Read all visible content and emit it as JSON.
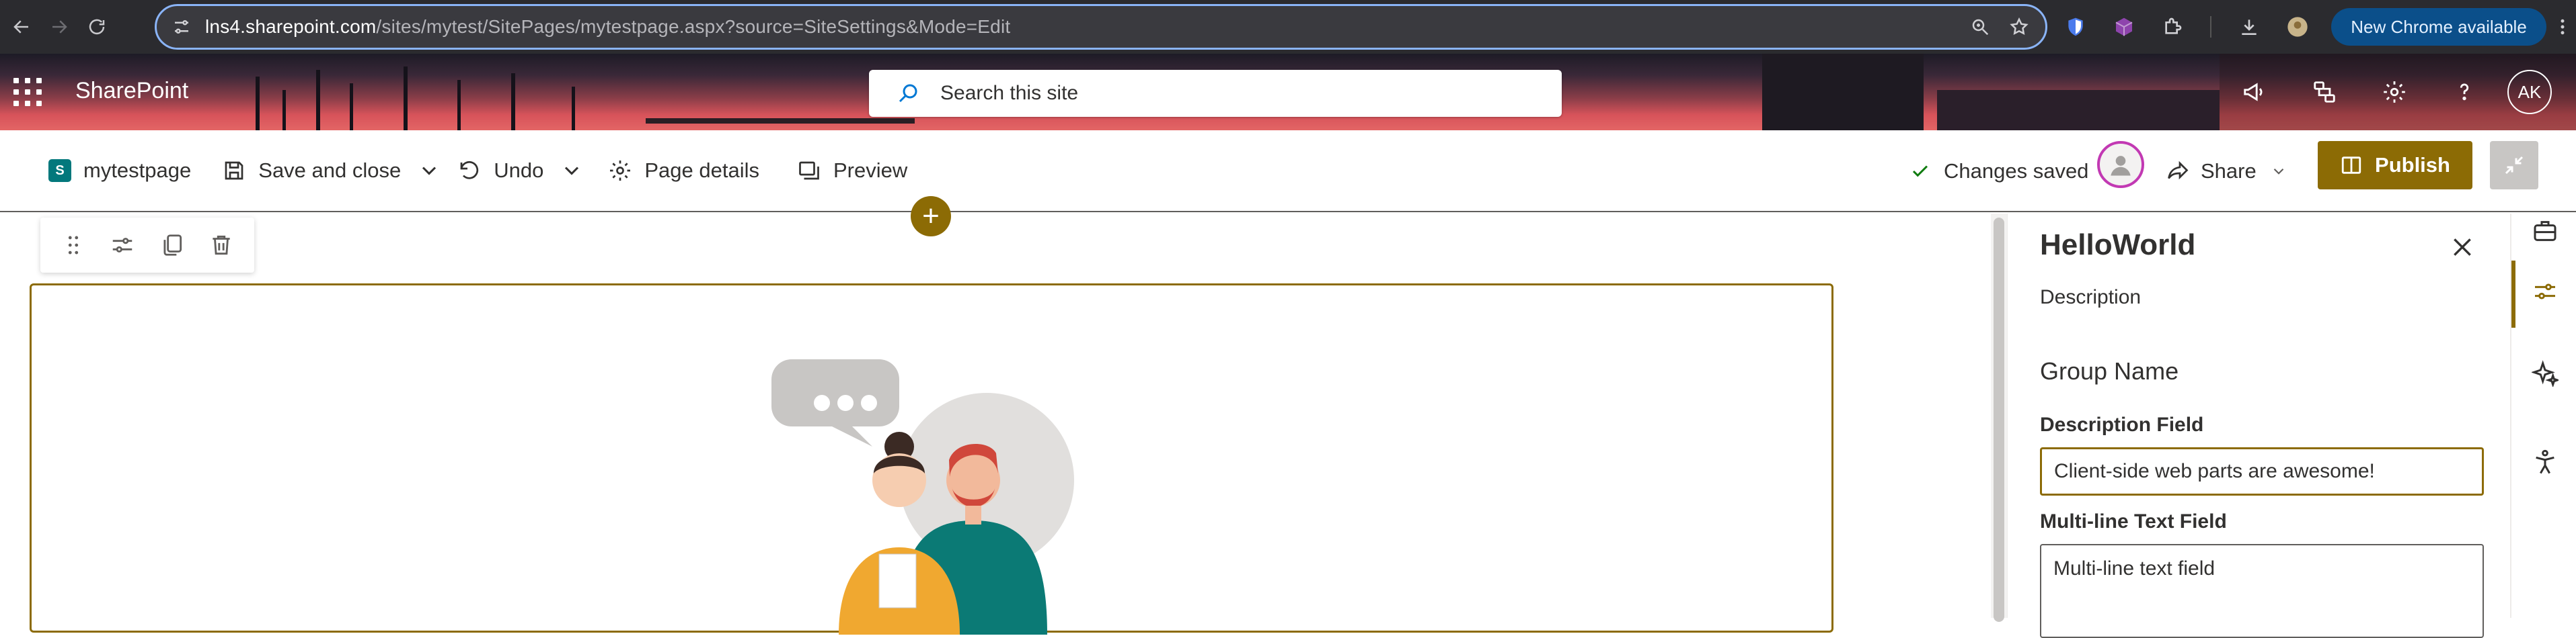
{
  "browser": {
    "url_host": "lns4.sharepoint.com",
    "url_path": "/sites/mytest/SitePages/mytestpage.aspx?source=SiteSettings&Mode=Edit",
    "new_chrome_label": "New Chrome available"
  },
  "suite": {
    "brand": "SharePoint",
    "search_placeholder": "Search this site",
    "avatar_initials": "AK"
  },
  "commandbar": {
    "page_name": "mytestpage",
    "save_label": "Save and close",
    "undo_label": "Undo",
    "page_details_label": "Page details",
    "preview_label": "Preview",
    "changes_status": "Changes saved",
    "share_label": "Share",
    "publish_label": "Publish"
  },
  "canvas": {
    "add_section_glyph": "+"
  },
  "property_pane": {
    "title": "HelloWorld",
    "description": "Description",
    "group_name": "Group Name",
    "description_field_label": "Description Field",
    "description_field_value": "Client-side web parts are awesome!",
    "multiline_label": "Multi-line Text Field",
    "multiline_value": "Multi-line text field"
  },
  "colors": {
    "accent": "#8c6b05",
    "chrome_bg": "#2b2b2f",
    "omnibox_border": "#8ab4f8",
    "check_green": "#107c10",
    "user_ring": "#c239b3"
  }
}
